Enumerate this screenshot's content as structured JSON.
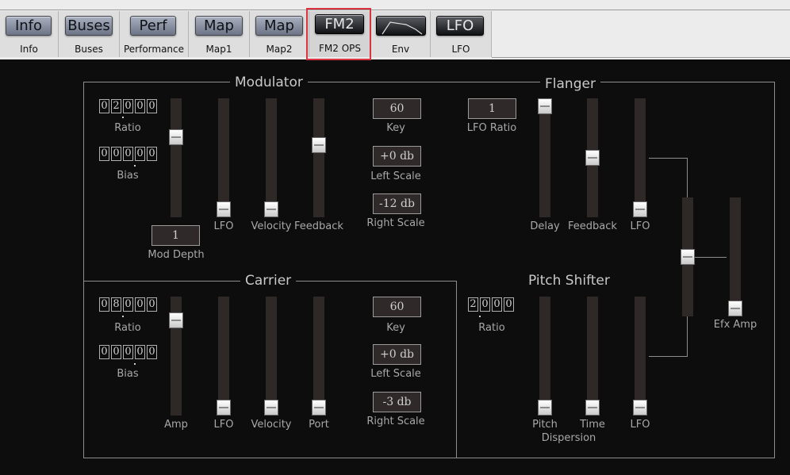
{
  "tabs": [
    {
      "button": "Info",
      "label": "Info"
    },
    {
      "button": "Buses",
      "label": "Buses"
    },
    {
      "button": "Perf",
      "label": "Performance"
    },
    {
      "button": "Map",
      "label": "Map1"
    },
    {
      "button": "Map",
      "label": "Map2"
    },
    {
      "button": "FM2",
      "label": "FM2 OPS",
      "active": true
    },
    {
      "button": "",
      "icon": "envelope-icon",
      "label": "Env"
    },
    {
      "button": "LFO",
      "label": "LFO"
    }
  ],
  "modulator": {
    "title": "Modulator",
    "ratio": {
      "digits": [
        "0",
        "2",
        "0",
        "0",
        "0"
      ],
      "label": "Ratio"
    },
    "bias": {
      "digits": [
        "0",
        "0",
        "0",
        "0",
        "0"
      ],
      "label": "Bias"
    },
    "mod_depth": {
      "value": "1",
      "label": "Mod Depth"
    },
    "sliders": [
      {
        "name": "Mod Depth",
        "level": 0.7
      },
      {
        "name": "LFO",
        "label": "LFO",
        "level": 0.0
      },
      {
        "name": "Velocity",
        "label": "Velocity",
        "level": 0.0
      },
      {
        "name": "Feedback",
        "label": "Feedback",
        "level": 0.62
      }
    ],
    "key": {
      "value": "60",
      "label": "Key"
    },
    "left_scale": {
      "value": "+0 db",
      "label": "Left Scale"
    },
    "right_scale": {
      "value": "-12 db",
      "label": "Right Scale"
    }
  },
  "carrier": {
    "title": "Carrier",
    "ratio": {
      "digits": [
        "0",
        "8",
        "0",
        "0",
        "0"
      ],
      "label": "Ratio"
    },
    "bias": {
      "digits": [
        "0",
        "0",
        "0",
        "0",
        "0"
      ],
      "label": "Bias"
    },
    "sliders": [
      {
        "name": "Amp",
        "label": "Amp",
        "level": 0.85
      },
      {
        "name": "LFO",
        "label": "LFO",
        "level": 0.0
      },
      {
        "name": "Velocity",
        "label": "Velocity",
        "level": 0.0
      },
      {
        "name": "Port",
        "label": "Port",
        "level": 0.0
      }
    ],
    "key": {
      "value": "60",
      "label": "Key"
    },
    "left_scale": {
      "value": "+0 db",
      "label": "Left Scale"
    },
    "right_scale": {
      "value": "-3 db",
      "label": "Right Scale"
    }
  },
  "flanger": {
    "title": "Flanger",
    "lfo_ratio": {
      "value": "1",
      "label": "LFO Ratio"
    },
    "sliders": [
      {
        "name": "Delay",
        "label": "Delay",
        "level": 1.0
      },
      {
        "name": "Feedback",
        "label": "Feedback",
        "level": 0.5
      },
      {
        "name": "LFO",
        "label": "LFO",
        "level": 0.0
      }
    ]
  },
  "pitch_shifter": {
    "title": "Pitch Shifter",
    "ratio": {
      "digits": [
        "2",
        "0",
        "0",
        "0"
      ],
      "label": "Ratio"
    },
    "sliders": [
      {
        "name": "Pitch Dispersion",
        "label": "Pitch",
        "level": 0.0
      },
      {
        "name": "Time Dispersion",
        "label": "Time",
        "level": 0.0
      },
      {
        "name": "LFO",
        "label": "LFO",
        "level": 0.0
      }
    ],
    "dispersion_label": "Dispersion"
  },
  "mix": {
    "level": 0.5
  },
  "efx_amp": {
    "label": "Efx Amp",
    "level": 0.0
  },
  "colors": {
    "highlight": "#d9343f",
    "track": "#2e2827",
    "panel_bg": "#0d0d0d"
  }
}
